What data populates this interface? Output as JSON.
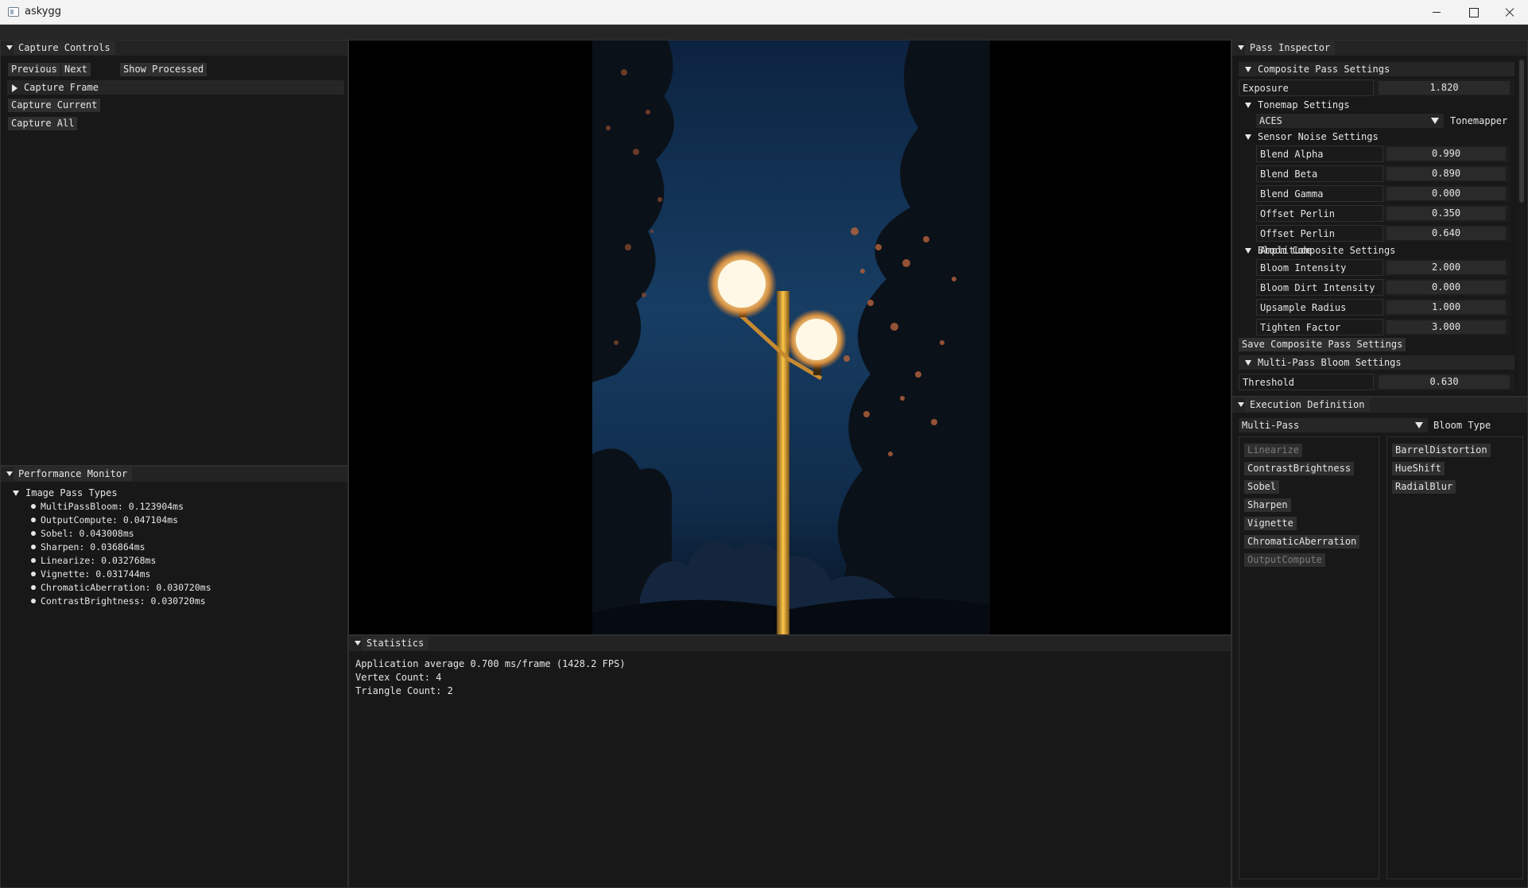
{
  "window": {
    "title": "askygg"
  },
  "capture_controls": {
    "title": "Capture Controls",
    "previous": "Previous",
    "next": "Next",
    "show_processed": "Show Processed",
    "capture_frame": "Capture Frame",
    "capture_current": "Capture Current",
    "capture_all": "Capture All"
  },
  "performance_monitor": {
    "title": "Performance Monitor",
    "group": "Image Pass Types",
    "items": [
      "MultiPassBloom: 0.123904ms",
      "OutputCompute: 0.047104ms",
      "Sobel: 0.043008ms",
      "Sharpen: 0.036864ms",
      "Linearize: 0.032768ms",
      "Vignette: 0.031744ms",
      "ChromaticAberration: 0.030720ms",
      "ContrastBrightness: 0.030720ms"
    ]
  },
  "statistics": {
    "title": "Statistics",
    "lines": [
      "Application average 0.700 ms/frame (1428.2 FPS)",
      "Vertex Count: 4",
      "Triangle Count: 2"
    ]
  },
  "pass_inspector": {
    "title": "Pass Inspector",
    "composite_header": "Composite Pass Settings",
    "exposure": {
      "label": "Exposure",
      "value": "1.820"
    },
    "tonemap_header": "Tonemap Settings",
    "tonemapper": {
      "value": "ACES",
      "label": "Tonemapper"
    },
    "sensor_header": "Sensor Noise Settings",
    "sensor": [
      {
        "label": "Blend Alpha",
        "value": "0.990"
      },
      {
        "label": "Blend Beta",
        "value": "0.890"
      },
      {
        "label": "Blend Gamma",
        "value": "0.000"
      },
      {
        "label": "Offset Perlin Frequency",
        "value": "0.350"
      },
      {
        "label": "Offset Perlin Amplitude",
        "value": "0.640"
      }
    ],
    "bloom_header": "Bloom Composite Settings",
    "bloom": [
      {
        "label": "Bloom Intensity",
        "value": "2.000"
      },
      {
        "label": "Bloom Dirt Intensity",
        "value": "0.000"
      },
      {
        "label": "Upsample Radius",
        "value": "1.000"
      },
      {
        "label": "Tighten Factor",
        "value": "3.000"
      }
    ],
    "save_button": "Save Composite Pass Settings",
    "multipass_header": "Multi-Pass Bloom Settings",
    "threshold": {
      "label": "Threshold",
      "value": "0.630"
    }
  },
  "execution_definition": {
    "title": "Execution Definition",
    "bloom_type": {
      "value": "Multi-Pass",
      "label": "Bloom Type"
    },
    "left_list": [
      {
        "label": "Linearize",
        "enabled": false
      },
      {
        "label": "ContrastBrightness",
        "enabled": true
      },
      {
        "label": "Sobel",
        "enabled": true
      },
      {
        "label": "Sharpen",
        "enabled": true
      },
      {
        "label": "Vignette",
        "enabled": true
      },
      {
        "label": "ChromaticAberration",
        "enabled": true
      },
      {
        "label": "OutputCompute",
        "enabled": false
      }
    ],
    "right_list": [
      {
        "label": "BarrelDistortion",
        "enabled": true
      },
      {
        "label": "HueShift",
        "enabled": true
      },
      {
        "label": "RadialBlur",
        "enabled": true
      }
    ]
  }
}
